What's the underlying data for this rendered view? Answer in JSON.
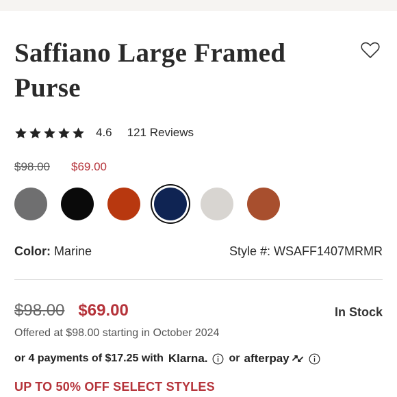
{
  "product": {
    "title": "Saffiano Large Framed Purse",
    "rating": "4.6",
    "reviews_label": "121 Reviews",
    "stars_filled": 5,
    "price_original": "$98.00",
    "price_sale": "$69.00"
  },
  "swatches": [
    {
      "name": "gray",
      "color": "#6f6f70",
      "selected": false
    },
    {
      "name": "black",
      "color": "#0a0a0a",
      "selected": false
    },
    {
      "name": "orange-red",
      "color": "#b8380f",
      "selected": false
    },
    {
      "name": "marine",
      "color": "#0f2453",
      "selected": true
    },
    {
      "name": "light-gray",
      "color": "#d8d5d1",
      "selected": false
    },
    {
      "name": "rust",
      "color": "#a84f2e",
      "selected": false
    }
  ],
  "details": {
    "color_label": "Color:",
    "color_value": "Marine",
    "style_label": "Style #: WSAFF1407MRMR"
  },
  "pricing": {
    "price_original": "$98.00",
    "price_sale": "$69.00",
    "stock_status": "In Stock",
    "offered_text": "Offered at $98.00 starting in October 2024",
    "payments_text": "or 4 payments of $17.25 with",
    "klarna_label": "Klarna.",
    "or_text": "or",
    "afterpay_label": "afterpay"
  },
  "promo": {
    "text": "UP TO 50% OFF SELECT STYLES"
  },
  "colors": {
    "sale_red": "#b5333a",
    "divider": "#dcdcdc"
  }
}
